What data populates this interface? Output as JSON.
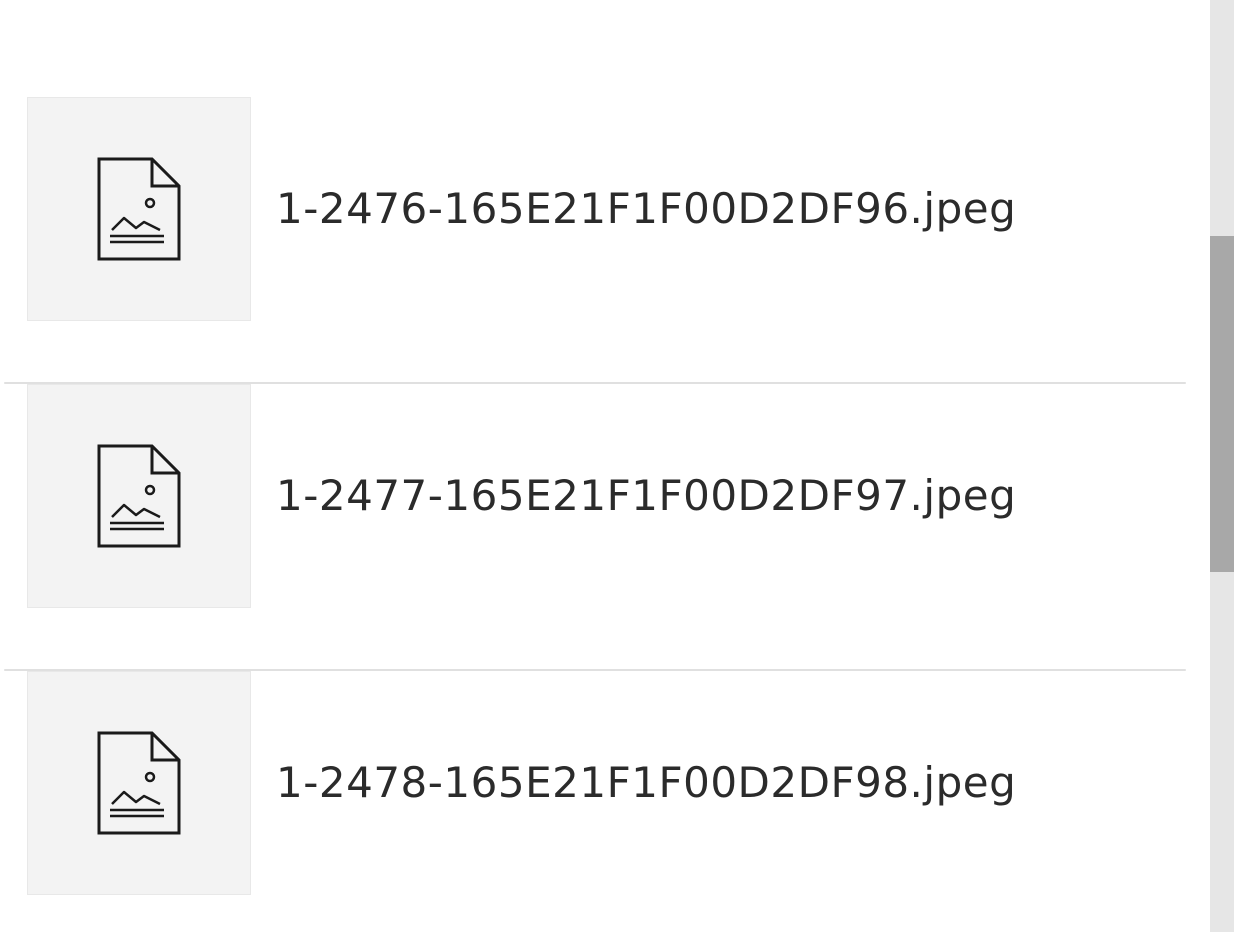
{
  "attachments": {
    "items": [
      {
        "name": "1-2476-165E21F1F00D2DF96.jpeg",
        "icon": "image-file-icon"
      },
      {
        "name": "1-2477-165E21F1F00D2DF97.jpeg",
        "icon": "image-file-icon"
      },
      {
        "name": "1-2478-165E21F1F00D2DF98.jpeg",
        "icon": "image-file-icon"
      }
    ]
  },
  "colors": {
    "thumbnail_background": "#f3f3f3",
    "divider": "#e0e0e0",
    "text": "#2b2b2b",
    "scrollbar_track": "#e6e6e6",
    "scrollbar_thumb": "#a8a8a8"
  }
}
